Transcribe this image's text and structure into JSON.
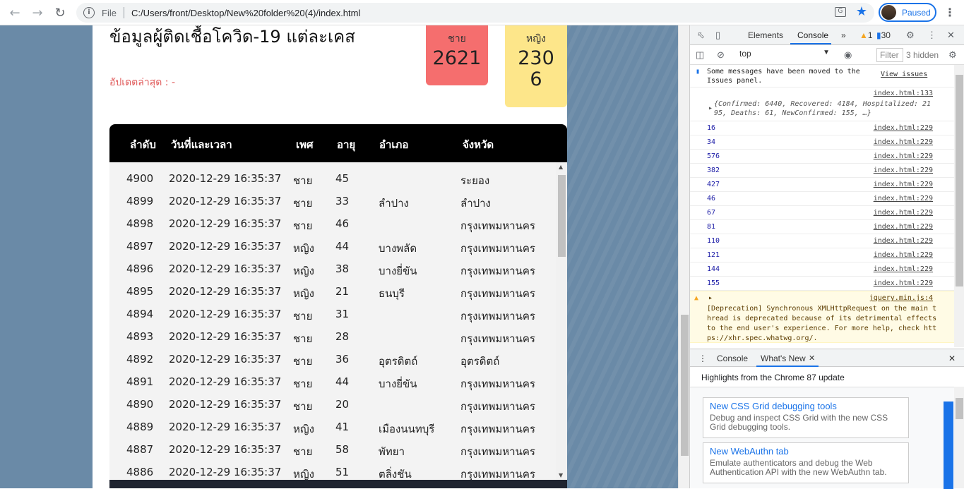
{
  "browser": {
    "back_icon": "arrow-left",
    "forward_icon": "arrow-right",
    "reload_icon": "reload",
    "scheme_label": "File",
    "url": "C:/Users/front/Desktop/New%20folder%20(4)/index.html",
    "profile_label": "Paused"
  },
  "page": {
    "title": "ข้อมูลผู้ติดเชื้อโควิด-19 แต่ละเคส",
    "update_label": "อัปเดตล่าสุด : -",
    "male": {
      "label": "ชาย",
      "value": "2621"
    },
    "female": {
      "label": "หญิง",
      "value": "2306"
    },
    "table": {
      "headers": [
        "ลำดับ",
        "วันที่และเวลา",
        "เพศ",
        "อายุ",
        "อำเภอ",
        "จังหวัด"
      ],
      "rows": [
        {
          "no": "4900",
          "datetime": "2020-12-29 16:35:37",
          "sex": "ชาย",
          "age": "45",
          "district": "",
          "province": "ระยอง"
        },
        {
          "no": "4899",
          "datetime": "2020-12-29 16:35:37",
          "sex": "ชาย",
          "age": "33",
          "district": "ลำปาง",
          "province": "ลำปาง"
        },
        {
          "no": "4898",
          "datetime": "2020-12-29 16:35:37",
          "sex": "ชาย",
          "age": "46",
          "district": "",
          "province": "กรุงเทพมหานคร"
        },
        {
          "no": "4897",
          "datetime": "2020-12-29 16:35:37",
          "sex": "หญิง",
          "age": "44",
          "district": "บางพลัด",
          "province": "กรุงเทพมหานคร"
        },
        {
          "no": "4896",
          "datetime": "2020-12-29 16:35:37",
          "sex": "หญิง",
          "age": "38",
          "district": "บางยี่ขัน",
          "province": "กรุงเทพมหานคร"
        },
        {
          "no": "4895",
          "datetime": "2020-12-29 16:35:37",
          "sex": "หญิง",
          "age": "21",
          "district": "ธนบุรี",
          "province": "กรุงเทพมหานคร"
        },
        {
          "no": "4894",
          "datetime": "2020-12-29 16:35:37",
          "sex": "ชาย",
          "age": "31",
          "district": "",
          "province": "กรุงเทพมหานคร"
        },
        {
          "no": "4893",
          "datetime": "2020-12-29 16:35:37",
          "sex": "ชาย",
          "age": "28",
          "district": "",
          "province": "กรุงเทพมหานคร"
        },
        {
          "no": "4892",
          "datetime": "2020-12-29 16:35:37",
          "sex": "ชาย",
          "age": "36",
          "district": "อุตรดิตถ์",
          "province": "อุตรดิตถ์"
        },
        {
          "no": "4891",
          "datetime": "2020-12-29 16:35:37",
          "sex": "ชาย",
          "age": "44",
          "district": "บางยี่ขัน",
          "province": "กรุงเทพมหานคร"
        },
        {
          "no": "4890",
          "datetime": "2020-12-29 16:35:37",
          "sex": "ชาย",
          "age": "20",
          "district": "",
          "province": "กรุงเทพมหานคร"
        },
        {
          "no": "4889",
          "datetime": "2020-12-29 16:35:37",
          "sex": "หญิง",
          "age": "41",
          "district": "เมืองนนทบุรี",
          "province": "กรุงเทพมหานคร"
        },
        {
          "no": "4887",
          "datetime": "2020-12-29 16:35:37",
          "sex": "ชาย",
          "age": "58",
          "district": "พัทยา",
          "province": "กรุงเทพมหานคร"
        },
        {
          "no": "4886",
          "datetime": "2020-12-29 16:35:37",
          "sex": "หญิง",
          "age": "51",
          "district": "ตลิ่งชัน",
          "province": "กรุงเทพมหานคร"
        }
      ]
    }
  },
  "devtools": {
    "tabs": [
      "Elements",
      "Console"
    ],
    "more_tabs": "»",
    "warnings": "1",
    "messages": "30",
    "context": "top",
    "filter_placeholder": "Filter",
    "hidden": "3 hidden",
    "issues_message": "Some messages have been moved to the Issues panel.",
    "view_issues": "View issues",
    "object_source": "index.html:133",
    "object_preview": "{Confirmed: 6440, Recovered: 4184, Hospitalized: 2195, Deaths: 61, NewConfirmed: 155, …}",
    "logs": [
      {
        "value": "16",
        "source": "index.html:229"
      },
      {
        "value": "34",
        "source": "index.html:229"
      },
      {
        "value": "576",
        "source": "index.html:229"
      },
      {
        "value": "382",
        "source": "index.html:229"
      },
      {
        "value": "427",
        "source": "index.html:229"
      },
      {
        "value": "46",
        "source": "index.html:229"
      },
      {
        "value": "67",
        "source": "index.html:229"
      },
      {
        "value": "81",
        "source": "index.html:229"
      },
      {
        "value": "110",
        "source": "index.html:229"
      },
      {
        "value": "121",
        "source": "index.html:229"
      },
      {
        "value": "144",
        "source": "index.html:229"
      },
      {
        "value": "155",
        "source": "index.html:229"
      }
    ],
    "warning_source": "jquery.min.js:4",
    "warning_text": "[Deprecation] Synchronous XMLHttpRequest on the main thread is deprecated because of its detrimental effects to the end user's experience. For more help, check https://xhr.spec.whatwg.org/.",
    "drawer_tabs": [
      "Console",
      "What's New"
    ],
    "drawer_header": "Highlights from the Chrome 87 update",
    "whats_new": [
      {
        "title": "New CSS Grid debugging tools",
        "desc": "Debug and inspect CSS Grid with the new CSS Grid debugging tools."
      },
      {
        "title": "New WebAuthn tab",
        "desc": "Emulate authenticators and debug the Web Authentication API with the new WebAuthn tab."
      }
    ]
  }
}
